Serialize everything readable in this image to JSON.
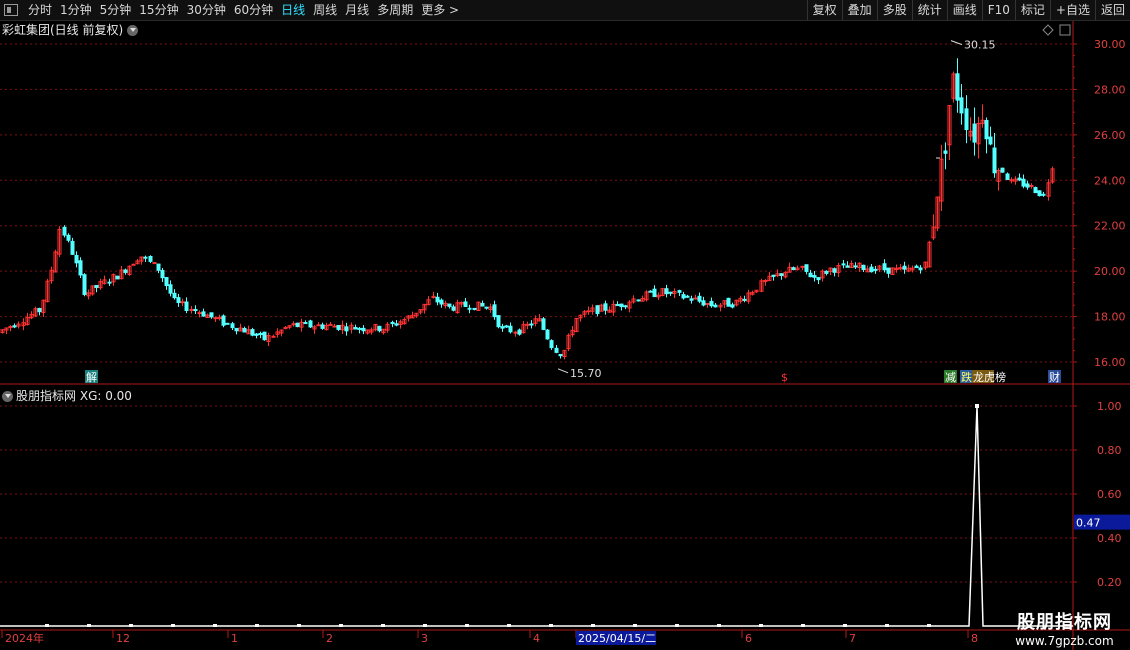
{
  "toolbar": {
    "timeframes": [
      "分时",
      "1分钟",
      "5分钟",
      "15分钟",
      "30分钟",
      "60分钟",
      "日线",
      "周线",
      "月线",
      "多周期",
      "更多 >"
    ],
    "active": "日线",
    "right_buttons": [
      "复权",
      "叠加",
      "多股",
      "统计",
      "画线",
      "F10",
      "标记",
      "+自选",
      "返回"
    ]
  },
  "main_chart": {
    "title": "彩虹集团(日线 前复权)",
    "high_label": "30.15",
    "low_label": "15.70",
    "ylabels": [
      "30.00",
      "28.00",
      "26.00",
      "24.00",
      "22.00",
      "20.00",
      "18.00",
      "16.00"
    ],
    "markers": [
      "解",
      "$",
      "减",
      "跌",
      "龙虎榜",
      "财"
    ]
  },
  "indicator": {
    "title": "股朋指标网",
    "value_text": "XG: 0.00",
    "ylabels": [
      "1.00",
      "0.80",
      "0.60",
      "0.40",
      "0.20"
    ],
    "current_badge": "0.47"
  },
  "xaxis": {
    "labels": [
      "2024年",
      "12",
      "1",
      "2",
      "3",
      "4",
      "2025/04/15/二",
      "6",
      "7",
      "8"
    ]
  },
  "watermark": {
    "line1": "股朋指标网",
    "line2": "www.7gpzb.com"
  },
  "colors": {
    "up": "#ff3232",
    "down": "#54ffff",
    "grid": "#7a1010",
    "axis": "#b01818",
    "active": "#33e0ff"
  },
  "chart_data": {
    "type": "candlestick",
    "title": "彩虹集团(日线 前复权)",
    "y_range": [
      15.2,
      30.8
    ],
    "high": 30.15,
    "low": 15.7,
    "indicator": {
      "name": "XG",
      "y_range": [
        0,
        1.05
      ],
      "spike_value": 1.0
    }
  }
}
